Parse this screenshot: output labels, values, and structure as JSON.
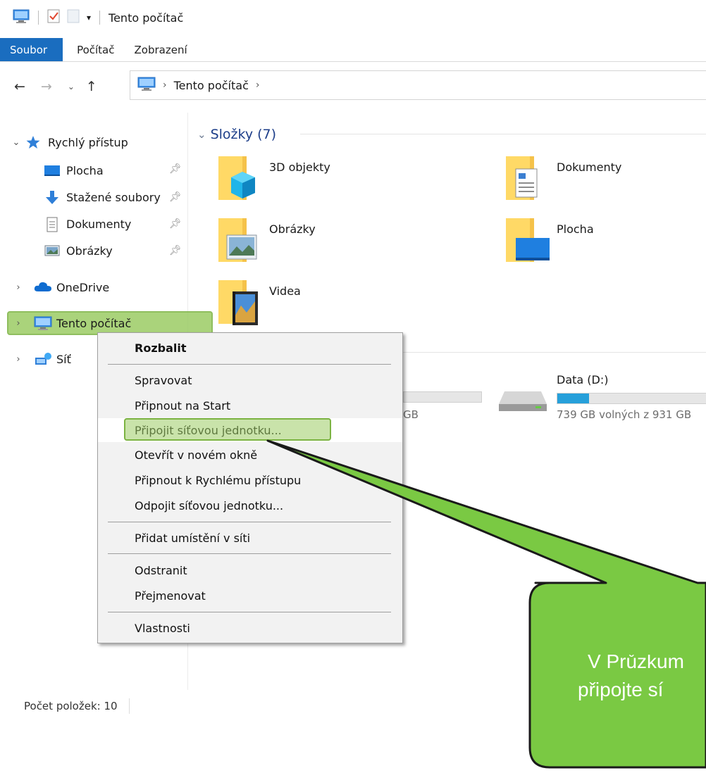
{
  "window": {
    "title": "Tento počítač"
  },
  "ribbon": {
    "tabs": [
      {
        "label": "Soubor",
        "active": true
      },
      {
        "label": "Počítač"
      },
      {
        "label": "Zobrazení"
      }
    ]
  },
  "address": {
    "path": [
      "Tento počítač"
    ]
  },
  "nav": {
    "quick_access": "Rychlý přístup",
    "items": [
      {
        "label": "Plocha",
        "icon": "desktop-icon",
        "pinned": true
      },
      {
        "label": "Stažené soubory",
        "icon": "download-arrow-icon",
        "pinned": true
      },
      {
        "label": "Dokumenty",
        "icon": "document-icon",
        "pinned": true
      },
      {
        "label": "Obrázky",
        "icon": "picture-icon",
        "pinned": true
      }
    ],
    "onedrive": "OneDrive",
    "this_pc": "Tento počítač",
    "network": "Síť"
  },
  "content": {
    "folders_header": "Složky (7)",
    "folders": [
      {
        "label": "3D objekty",
        "icon": "folder-3d-icon"
      },
      {
        "label": "Dokumenty",
        "icon": "folder-documents-icon"
      },
      {
        "label": "Obrázky",
        "icon": "folder-pictures-icon"
      },
      {
        "label": "Plocha",
        "icon": "folder-desktop-icon"
      },
      {
        "label": "Videa",
        "icon": "folder-videos-icon"
      }
    ],
    "drive_partial_text": "GB",
    "drive": {
      "label": "Data (D:)",
      "free_text": "739 GB volných z 931 GB",
      "used_fraction": 0.206
    }
  },
  "status": {
    "item_count": "Počet položek: 10"
  },
  "context_menu": {
    "items": [
      {
        "label": "Rozbalit",
        "bold": true
      },
      {
        "label": "Spravovat"
      },
      {
        "label": "Připnout na Start"
      },
      {
        "label": "Připojit síťovou jednotku...",
        "highlighted": true
      },
      {
        "label": "Otevřít v novém okně"
      },
      {
        "label": "Připnout k Rychlému přístupu"
      },
      {
        "label": "Odpojit síťovou jednotku..."
      },
      {
        "label": "Přidat umístění v síti"
      },
      {
        "label": "Odstranit"
      },
      {
        "label": "Přejmenovat"
      },
      {
        "label": "Vlastnosti"
      }
    ]
  },
  "callout": {
    "line1": "V Průzkum",
    "line2": "připojte sí"
  },
  "colors": {
    "accent_blue": "#1a6dbf",
    "highlight_green": "#7cb342",
    "callout_green": "#7ac943",
    "drive_fill": "#26a0da"
  }
}
